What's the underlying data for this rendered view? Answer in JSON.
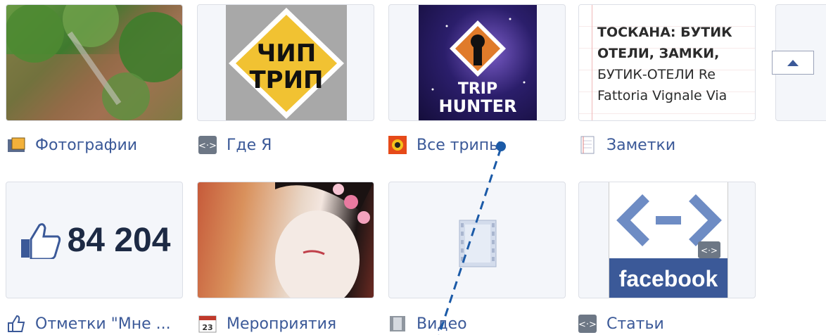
{
  "apps": {
    "photos": {
      "label": "Фотографии"
    },
    "where": {
      "label": "Где Я"
    },
    "trips": {
      "label": "Все трипы"
    },
    "notes": {
      "label": "Заметки",
      "preview_lines": [
        "ТОСКАНА: БУТИК",
        "ОТЕЛИ, ЗАМКИ,",
        "БУТИК-ОТЕЛИ  Re",
        "Fattoria Vignale Via"
      ]
    },
    "likes": {
      "label": "Отметки \"Мне ...",
      "count": "84 204"
    },
    "events": {
      "label": "Мероприятия",
      "calendar_day": "23"
    },
    "video": {
      "label": "Видео"
    },
    "articles": {
      "label": "Статьи",
      "brand": "facebook"
    }
  },
  "trip_logo": {
    "line1": "TRIP",
    "line2": "HUNTER"
  },
  "where_logo": {
    "line1": "ЧИП",
    "line2": "ТРИП"
  },
  "colors": {
    "link": "#3b5998",
    "annotation": "#1b5aa7"
  }
}
